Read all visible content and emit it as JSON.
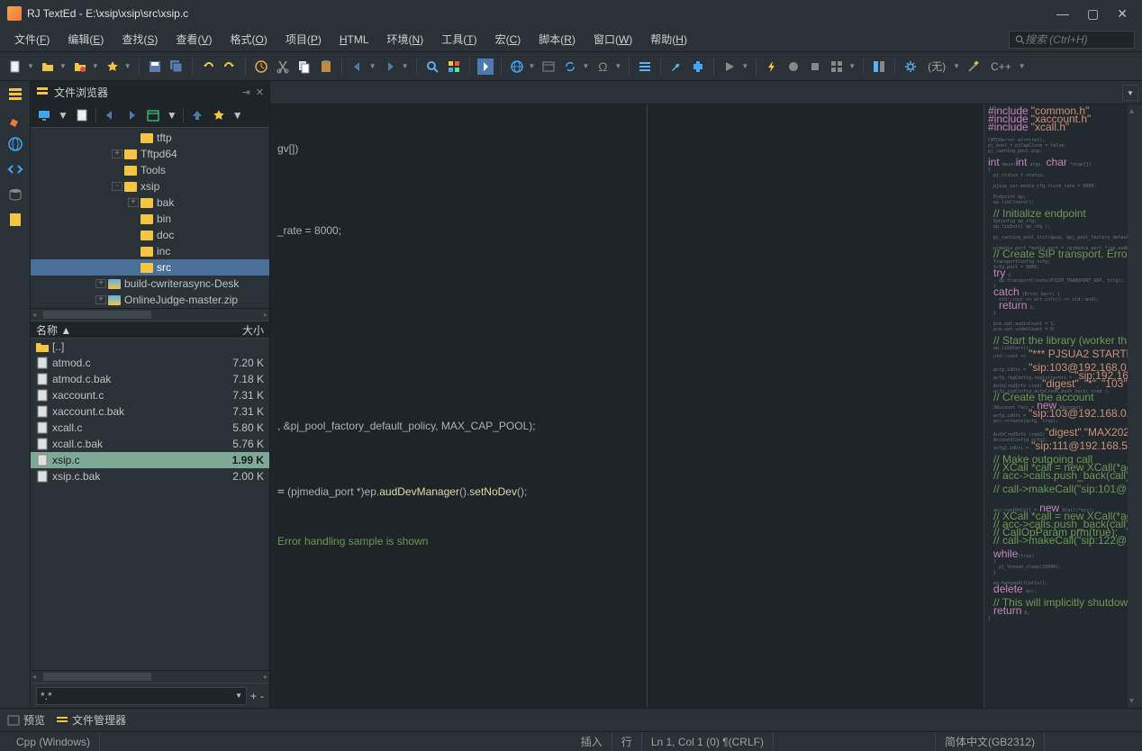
{
  "titlebar": {
    "app_name": "RJ TextEd",
    "file_path": "E:\\xsip\\xsip\\src\\xsip.c"
  },
  "menu": {
    "items": [
      {
        "label": "文件",
        "key": "F"
      },
      {
        "label": "编辑",
        "key": "E"
      },
      {
        "label": "查找",
        "key": "S"
      },
      {
        "label": "查看",
        "key": "V"
      },
      {
        "label": "格式",
        "key": "O"
      },
      {
        "label": "项目",
        "key": "P"
      },
      {
        "label": "HTML",
        "key": ""
      },
      {
        "label": "环境",
        "key": "N"
      },
      {
        "label": "工具",
        "key": "T"
      },
      {
        "label": "宏",
        "key": "C"
      },
      {
        "label": "脚本",
        "key": "R"
      },
      {
        "label": "窗口",
        "key": "W"
      },
      {
        "label": "帮助",
        "key": "H"
      }
    ],
    "search_placeholder": "搜索 (Ctrl+H)"
  },
  "toolbar": {
    "lang_none": "(无)",
    "lang_cpp": "C++"
  },
  "panel": {
    "title": "文件浏览器",
    "tree": [
      {
        "indent": 6,
        "exp": "",
        "label": "tftp"
      },
      {
        "indent": 5,
        "exp": "+",
        "label": "Tftpd64"
      },
      {
        "indent": 5,
        "exp": "",
        "label": "Tools"
      },
      {
        "indent": 5,
        "exp": "-",
        "label": "xsip"
      },
      {
        "indent": 6,
        "exp": "+",
        "label": "bak"
      },
      {
        "indent": 6,
        "exp": "",
        "label": "bin"
      },
      {
        "indent": 6,
        "exp": "",
        "label": "doc"
      },
      {
        "indent": 6,
        "exp": "",
        "label": "inc"
      },
      {
        "indent": 6,
        "exp": "",
        "label": "src",
        "selected": true
      },
      {
        "indent": 4,
        "exp": "+",
        "label": "build-cwriterasync-Desk",
        "special": true
      },
      {
        "indent": 4,
        "exp": "+",
        "label": "OnlineJudge-master.zip",
        "special": true
      }
    ],
    "file_header": {
      "name": "名称 ▲",
      "size": "大小"
    },
    "files": [
      {
        "name": "[..]",
        "size": "",
        "icon": "folder"
      },
      {
        "name": "atmod.c",
        "size": "7.20 K",
        "icon": "file"
      },
      {
        "name": "atmod.c.bak",
        "size": "7.18 K",
        "icon": "file"
      },
      {
        "name": "xaccount.c",
        "size": "7.31 K",
        "icon": "file"
      },
      {
        "name": "xaccount.c.bak",
        "size": "7.31 K",
        "icon": "file"
      },
      {
        "name": "xcall.c",
        "size": "5.80 K",
        "icon": "file"
      },
      {
        "name": "xcall.c.bak",
        "size": "5.76 K",
        "icon": "file"
      },
      {
        "name": "xsip.c",
        "size": "1.99 K",
        "icon": "file",
        "selected": true
      },
      {
        "name": "xsip.c.bak",
        "size": "2.00 K",
        "icon": "file"
      }
    ],
    "filter": "*.*"
  },
  "editor": {
    "code_fragments": {
      "l1": "gv[])",
      "l2": "_rate = 8000;",
      "l3": ", &pj_pool_factory_default_policy, MAX_CAP_POOL);",
      "l4a": " (pjmedia_port *)ep.",
      "l4b": "audDevManager",
      "l4c": "().",
      "l4d": "setNoDev",
      "l4e": "();",
      "l5": "Error handling sample is shown"
    }
  },
  "bottom_tabs": {
    "preview": "预览",
    "file_manager": "文件管理器"
  },
  "statusbar": {
    "lang": "Cpp (Windows)",
    "insert": "插入",
    "line_label": "行",
    "position": "Ln 1, Col 1 (0) ¶(CRLF)",
    "encoding": "简体中文(GB2312)"
  }
}
